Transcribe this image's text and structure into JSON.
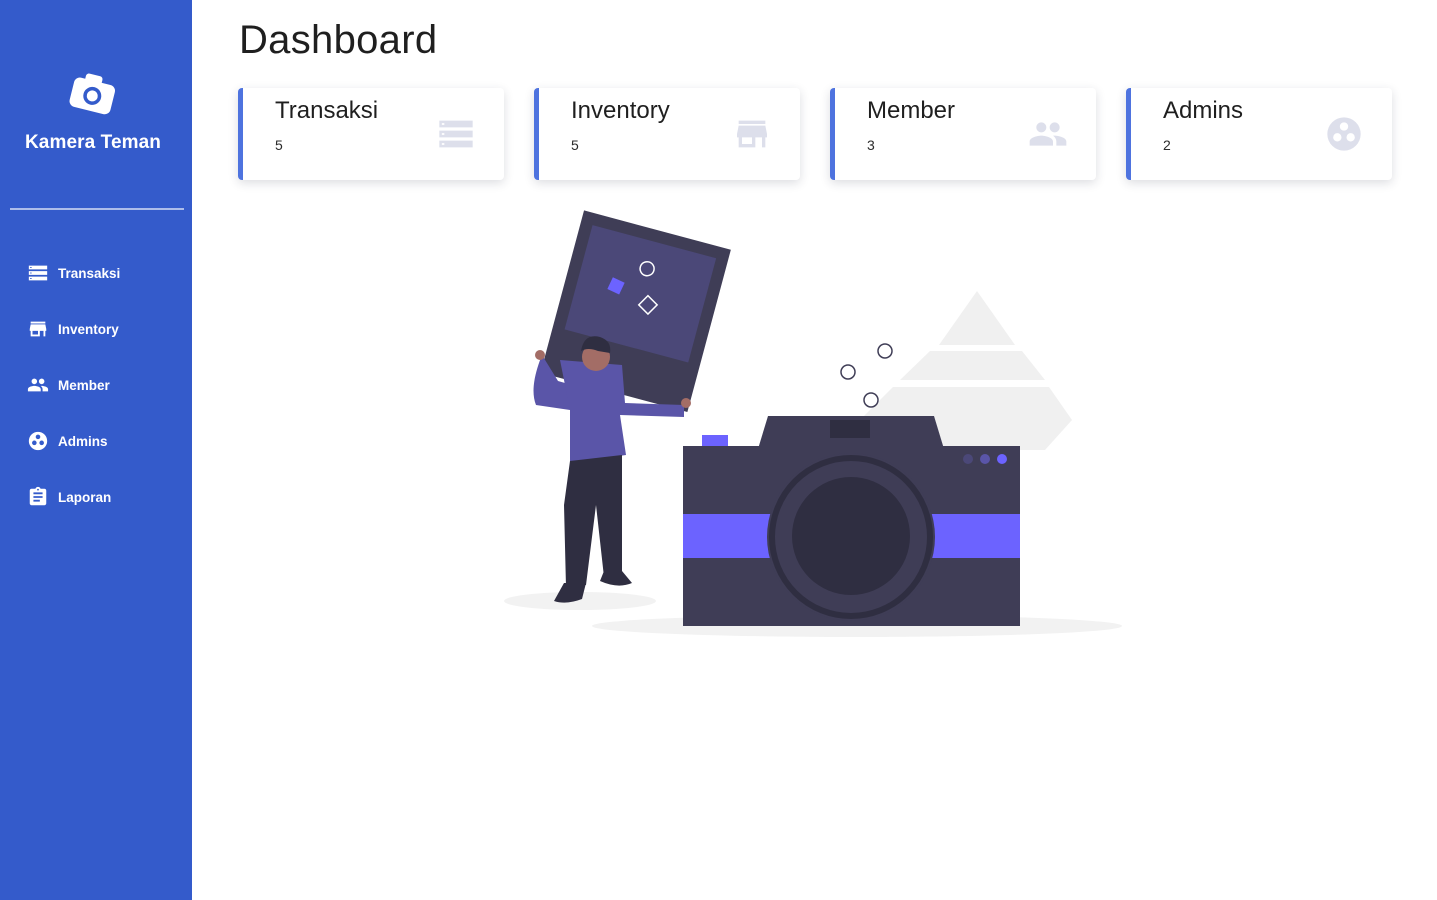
{
  "brand": {
    "name": "Kamera Teman",
    "logo_icon": "camera-icon"
  },
  "nav": [
    {
      "label": "Transaksi",
      "icon": "list-icon"
    },
    {
      "label": "Inventory",
      "icon": "store-icon"
    },
    {
      "label": "Member",
      "icon": "people-icon"
    },
    {
      "label": "Admins",
      "icon": "group-icon"
    },
    {
      "label": "Laporan",
      "icon": "clipboard-icon"
    }
  ],
  "page": {
    "title": "Dashboard"
  },
  "cards": [
    {
      "title": "Transaksi",
      "value": "5",
      "icon": "list-icon"
    },
    {
      "title": "Inventory",
      "value": "5",
      "icon": "store-icon"
    },
    {
      "title": "Member",
      "value": "3",
      "icon": "people-icon"
    },
    {
      "title": "Admins",
      "value": "2",
      "icon": "group-icon"
    }
  ],
  "colors": {
    "sidebar": "#345bcb",
    "card_accent": "#4e73df",
    "card_icon": "#dddfeb",
    "illustration_accent": "#6c63ff",
    "illustration_dark": "#3f3d56"
  }
}
